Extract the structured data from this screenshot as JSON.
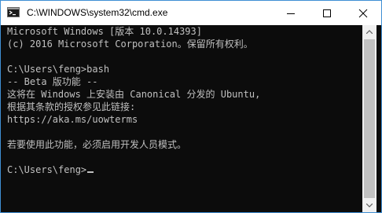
{
  "window": {
    "title": "C:\\WINDOWS\\system32\\cmd.exe",
    "app_icon": "cmd-console-icon"
  },
  "controls": {
    "minimize": "minimize-icon",
    "maximize": "maximize-icon",
    "close": "close-icon"
  },
  "console": {
    "lines": [
      "Microsoft Windows [版本 10.0.14393]",
      "(c) 2016 Microsoft Corporation。保留所有权利。",
      "",
      "C:\\Users\\feng>bash",
      "-- Beta 版功能 --",
      "这将在 Windows 上安装由 Canonical 分发的 Ubuntu,",
      "根据其条款的授权参见此链接:",
      "https://aka.ms/uowterms",
      "",
      "若要使用此功能，必须启用开发人员模式。",
      "",
      "C:\\Users\\feng>"
    ]
  },
  "colors": {
    "console_background": "#0c0c0c",
    "console_text": "#c0c0c0",
    "window_border": "#3f8fd4",
    "scrollbar_track": "#f0f0f0",
    "scrollbar_thumb": "#c1c1c1"
  }
}
